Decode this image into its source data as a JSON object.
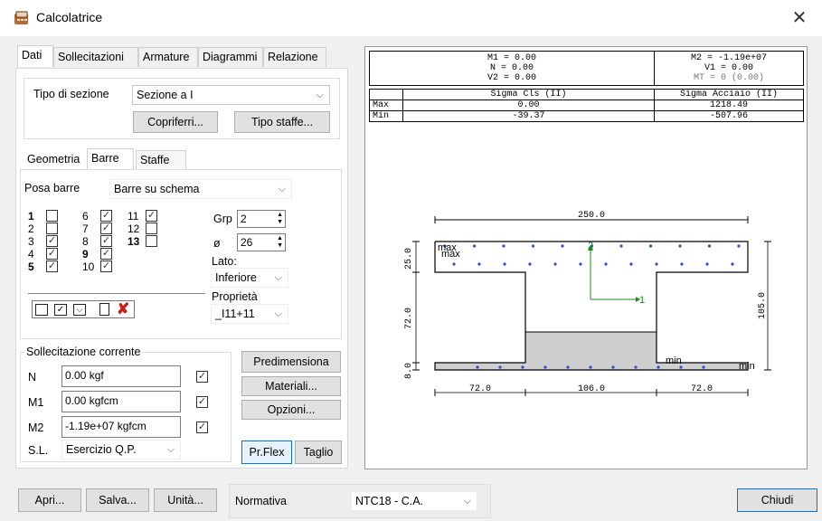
{
  "window": {
    "title": "Calcolatrice"
  },
  "tabs": [
    "Dati",
    "Sollecitazioni",
    "Armature",
    "Diagrammi",
    "Relazione"
  ],
  "section": {
    "label": "Tipo di sezione",
    "value": "Sezione a I",
    "btn_copriferri": "Copriferri...",
    "btn_tipo_staffe": "Tipo staffe..."
  },
  "subtabs": [
    "Geometria",
    "Barre",
    "Staffe"
  ],
  "barre": {
    "posa_label": "Posa barre",
    "posa_value": "Barre su schema",
    "grp_label": "Grp",
    "grp_value": "2",
    "diam_label": "ø",
    "diam_value": "26",
    "lato_label": "Lato:",
    "lato_value": "Inferiore",
    "prop_label": "Proprietà",
    "prop_value": "_I11+11",
    "bars": [
      {
        "n": "1",
        "bold": true,
        "checked": false
      },
      {
        "n": "2",
        "bold": false,
        "checked": false
      },
      {
        "n": "3",
        "bold": false,
        "checked": true
      },
      {
        "n": "4",
        "bold": false,
        "checked": true
      },
      {
        "n": "5",
        "bold": true,
        "checked": true
      },
      {
        "n": "6",
        "bold": false,
        "checked": true
      },
      {
        "n": "7",
        "bold": false,
        "checked": true
      },
      {
        "n": "8",
        "bold": false,
        "checked": true
      },
      {
        "n": "9",
        "bold": true,
        "checked": true
      },
      {
        "n": "10",
        "bold": false,
        "checked": true
      },
      {
        "n": "11",
        "bold": false,
        "checked": true
      },
      {
        "n": "12",
        "bold": false,
        "checked": false
      },
      {
        "n": "13",
        "bold": true,
        "checked": false
      }
    ]
  },
  "sollecitazione": {
    "group_label": "Sollecitazione corrente",
    "n_label": "N",
    "n_value": "0.00 kgf",
    "m1_label": "M1",
    "m1_value": "0.00 kgfcm",
    "m2_label": "M2",
    "m2_value": "-1.19e+07 kgfcm",
    "sl_label": "S.L.",
    "sl_value": "Esercizio Q.P."
  },
  "right_buttons": {
    "predimensiona": "Predimensiona",
    "materiali": "Materiali...",
    "opzioni": "Opzioni...",
    "prflex": "Pr.Flex",
    "taglio": "Taglio"
  },
  "bottom": {
    "apri": "Apri...",
    "salva": "Salva...",
    "unita": "Unità...",
    "normativa_label": "Normativa",
    "normativa_value": "NTC18 - C.A.",
    "chiudi": "Chiudi"
  },
  "results": {
    "m1": "M1 = 0.00",
    "n": "N = 0.00",
    "v2": "V2 = 0.00",
    "m2": "M2 = -1.19e+07",
    "v1": "V1 = 0.00",
    "mt": "MT = 0 (0.00)",
    "h_cls": "Sigma Cls (II)",
    "h_acc": "Sigma Acciaio (II)",
    "row_max": "Max",
    "row_min": "Min",
    "cls_max": "0.00",
    "cls_min": "-39.37",
    "acc_max": "1218.49",
    "acc_min": "-507.96"
  },
  "drawing": {
    "dim_top": "250.0",
    "dim_bot_left": "72.0",
    "dim_bot_mid": "106.0",
    "dim_bot_right": "72.0",
    "dim_left_top": "25.0",
    "dim_left_mid": "72.0",
    "dim_left_bot": "8.0",
    "dim_right": "105.0",
    "axis_1": "1",
    "axis_2": "2",
    "lbl_max": "max",
    "lbl_max2": "max",
    "lbl_min": "min",
    "lbl_min2": "min"
  }
}
